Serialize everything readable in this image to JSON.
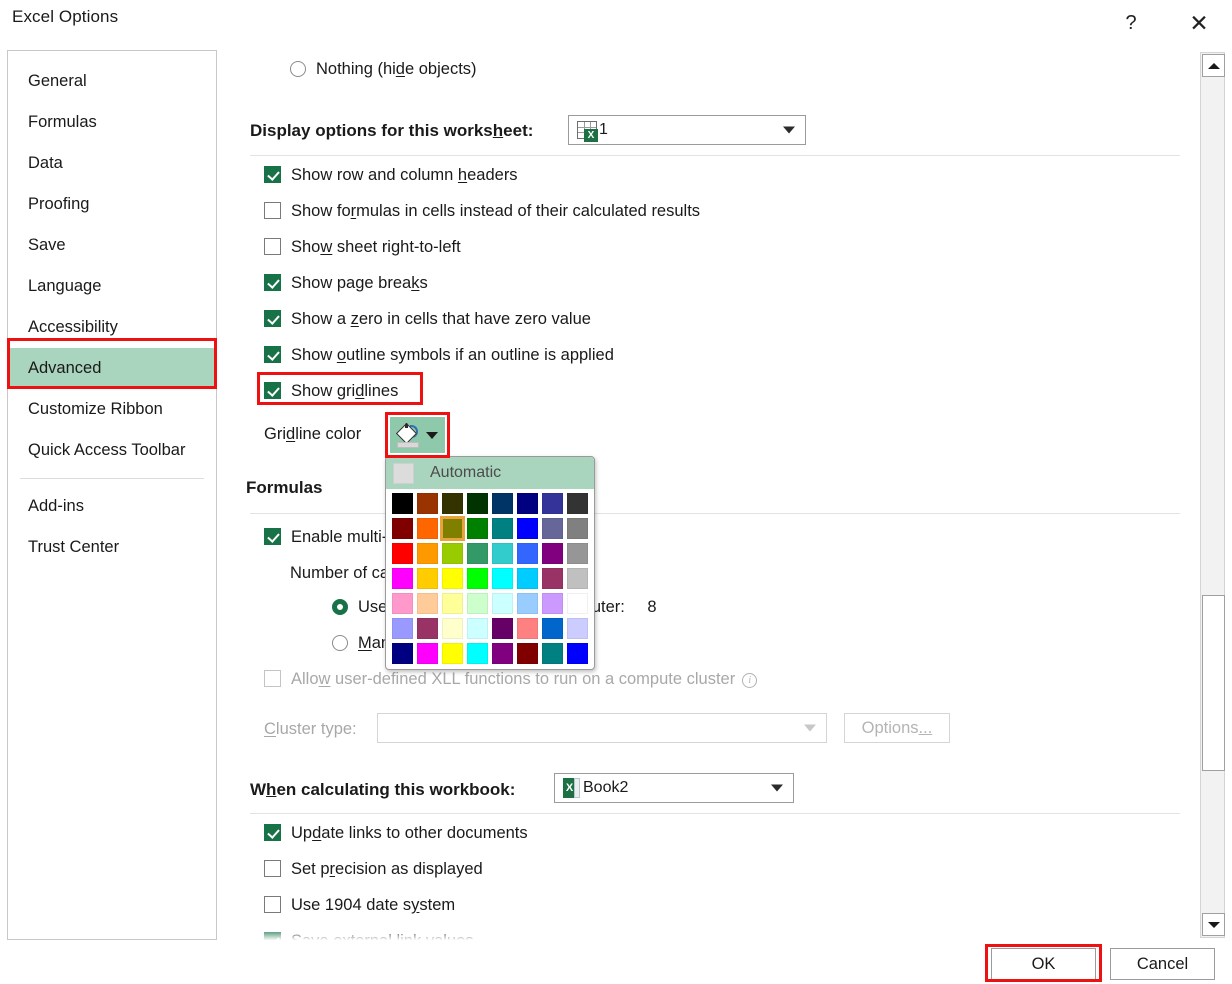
{
  "window": {
    "title": "Excel Options",
    "help_label": "?",
    "close_label": "✕"
  },
  "sidebar": {
    "items": [
      {
        "label": "General",
        "selected": false
      },
      {
        "label": "Formulas",
        "selected": false
      },
      {
        "label": "Data",
        "selected": false
      },
      {
        "label": "Proofing",
        "selected": false
      },
      {
        "label": "Save",
        "selected": false
      },
      {
        "label": "Language",
        "selected": false
      },
      {
        "label": "Accessibility",
        "selected": false
      },
      {
        "label": "Advanced",
        "selected": true
      },
      {
        "label": "Customize Ribbon",
        "selected": false
      },
      {
        "label": "Quick Access Toolbar",
        "selected": false
      },
      {
        "label": "Add-ins",
        "selected": false
      },
      {
        "label": "Trust Center",
        "selected": false
      }
    ]
  },
  "main": {
    "nothing_radio": "Nothing (hide objects)",
    "display_options_label": "Display options for this worksheet:",
    "worksheet_value": "1",
    "checkboxes": [
      {
        "label": "Show row and column headers",
        "checked": true
      },
      {
        "label": "Show formulas in cells instead of their calculated results",
        "checked": false
      },
      {
        "label": "Show sheet right-to-left",
        "checked": false
      },
      {
        "label": "Show page breaks",
        "checked": true
      },
      {
        "label": "Show a zero in cells that have zero value",
        "checked": true
      },
      {
        "label": "Show outline symbols if an outline is applied",
        "checked": true
      },
      {
        "label": "Show gridlines",
        "checked": true
      }
    ],
    "gridline_color_label": "Gridline color",
    "formulas_heading": "Formulas",
    "enable_multi_label": "Enable multi-threaded calculation",
    "number_of_label": "Number of calculation threads",
    "use_all_label": "Use all processors on this computer:",
    "processor_count": "8",
    "manual_label": "Manual",
    "allow_xll_label": "Allow user-defined XLL functions to run on a compute cluster",
    "cluster_type_label": "Cluster type:",
    "cluster_type_value": "",
    "options_button": "Options...",
    "when_calculating_label": "When calculating this workbook:",
    "workbook_value": "Book2",
    "bottom_checkboxes": [
      {
        "label": "Update links to other documents",
        "checked": true
      },
      {
        "label": "Set precision as displayed",
        "checked": false
      },
      {
        "label": "Use 1904 date system",
        "checked": false
      },
      {
        "label": "Save external link values",
        "checked": true
      }
    ]
  },
  "color_picker": {
    "automatic_label": "Automatic",
    "selected_color": "#808000",
    "rows": [
      [
        "#000000",
        "#993300",
        "#333300",
        "#003300",
        "#003366",
        "#000080",
        "#333399",
        "#333333"
      ],
      [
        "#800000",
        "#FF6600",
        "#808000",
        "#008000",
        "#008080",
        "#0000FF",
        "#666699",
        "#808080"
      ],
      [
        "#FF0000",
        "#FF9900",
        "#99CC00",
        "#339966",
        "#33CCCC",
        "#3366FF",
        "#800080",
        "#969696"
      ],
      [
        "#FF00FF",
        "#FFCC00",
        "#FFFF00",
        "#00FF00",
        "#00FFFF",
        "#00CCFF",
        "#993366",
        "#C0C0C0"
      ],
      [
        "#FF99CC",
        "#FFCC99",
        "#FFFF99",
        "#CCFFCC",
        "#CCFFFF",
        "#99CCFF",
        "#CC99FF",
        "#FFFFFF"
      ],
      [
        "#9999FF",
        "#993366",
        "#FFFFCC",
        "#CCFFFF",
        "#660066",
        "#FF8080",
        "#0066CC",
        "#CCCCFF"
      ],
      [
        "#000080",
        "#FF00FF",
        "#FFFF00",
        "#00FFFF",
        "#800080",
        "#800000",
        "#008080",
        "#0000FF"
      ]
    ]
  },
  "footer": {
    "ok_label": "OK",
    "cancel_label": "Cancel"
  },
  "highlights": {
    "color": "#EE1111"
  }
}
